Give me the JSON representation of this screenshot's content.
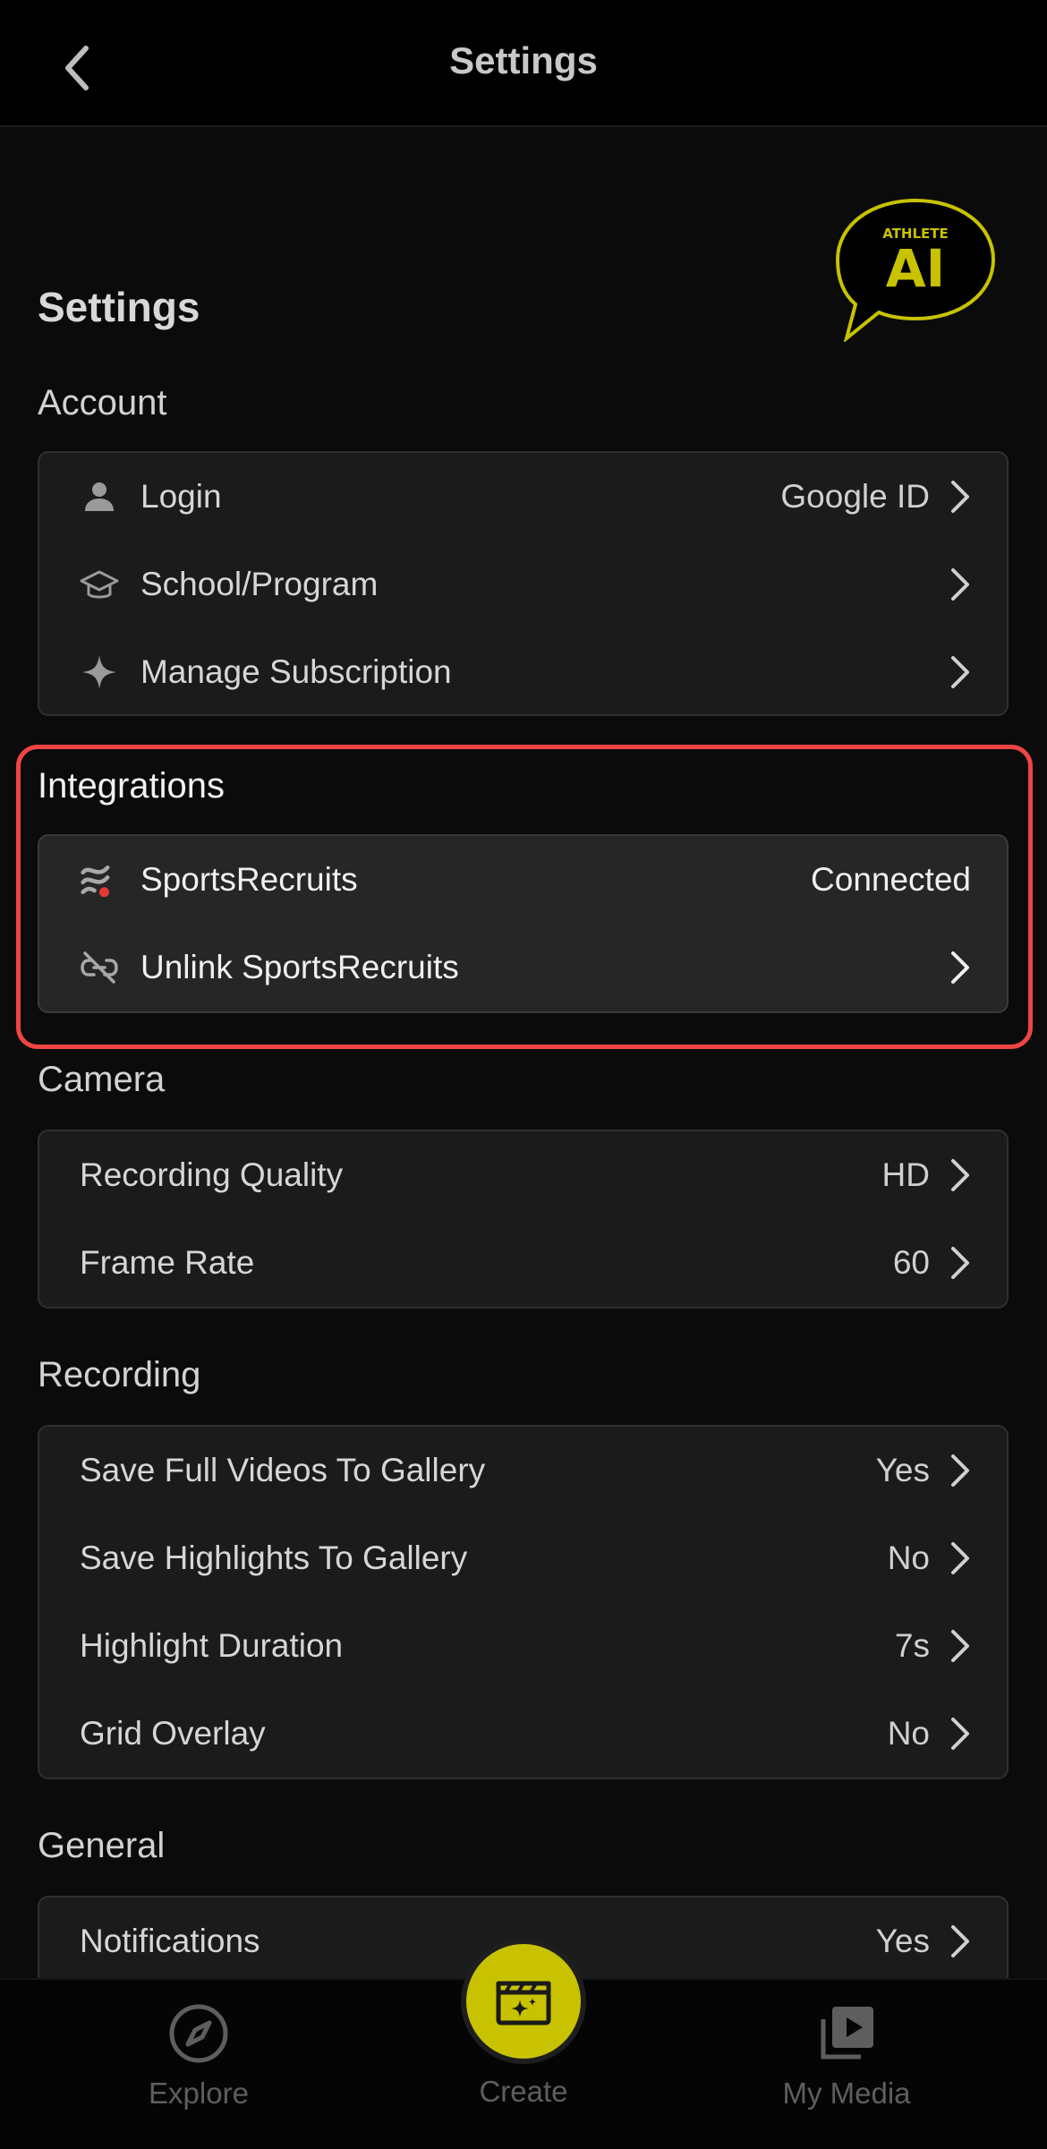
{
  "nav": {
    "title": "Settings"
  },
  "logo": {
    "text_top": "ATHLETE",
    "text_main": "AI"
  },
  "page_heading": "Settings",
  "sections": {
    "account": {
      "title": "Account",
      "items": [
        {
          "label": "Login",
          "value": "Google ID",
          "icon": "person-icon"
        },
        {
          "label": "School/Program",
          "value": "",
          "icon": "graduation-cap-icon"
        },
        {
          "label": "Manage Subscription",
          "value": "",
          "icon": "sparkle-icon"
        }
      ]
    },
    "integrations": {
      "title": "Integrations",
      "items": [
        {
          "label": "SportsRecruits",
          "value": "Connected",
          "icon": "sportsrecruits-logo-icon"
        },
        {
          "label": "Unlink SportsRecruits",
          "value": "",
          "icon": "unlink-icon"
        }
      ]
    },
    "camera": {
      "title": "Camera",
      "items": [
        {
          "label": "Recording Quality",
          "value": "HD"
        },
        {
          "label": "Frame Rate",
          "value": "60"
        }
      ]
    },
    "recording": {
      "title": "Recording",
      "items": [
        {
          "label": "Save Full Videos To Gallery",
          "value": "Yes"
        },
        {
          "label": "Save Highlights To Gallery",
          "value": "No"
        },
        {
          "label": "Highlight Duration",
          "value": "7s"
        },
        {
          "label": "Grid Overlay",
          "value": "No"
        }
      ]
    },
    "general": {
      "title": "General",
      "items": [
        {
          "label": "Notifications",
          "value": "Yes"
        }
      ]
    }
  },
  "tabs": {
    "explore": "Explore",
    "create": "Create",
    "my_media": "My Media"
  },
  "colors": {
    "accent": "#c8c200",
    "highlight": "#ef4444",
    "status_dot": "#e53935"
  }
}
